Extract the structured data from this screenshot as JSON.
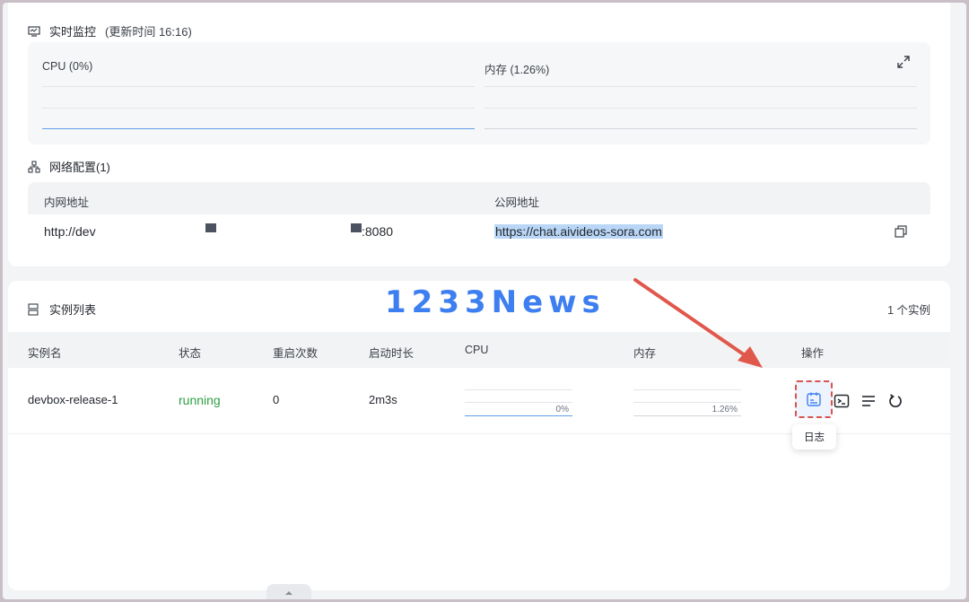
{
  "monitor": {
    "title": "实时监控",
    "updated": "(更新时间 16:16)",
    "cpu_label": "CPU (0%)",
    "mem_label": "内存 (1.26%)"
  },
  "network": {
    "title": "网络配置(1)",
    "col_internal": "内网地址",
    "col_public": "公网地址",
    "internal_prefix": "http://dev",
    "internal_suffix": ":8080",
    "public_url": "https://chat.aivideos-sora.com"
  },
  "instances": {
    "title": "实例列表",
    "count": "1 个实例",
    "columns": [
      "实例名",
      "状态",
      "重启次数",
      "启动时长",
      "CPU",
      "内存",
      "操作"
    ],
    "rows": [
      {
        "name": "devbox-release-1",
        "status": "running",
        "restarts": "0",
        "uptime": "2m3s",
        "cpu": "0%",
        "mem": "1.26%"
      }
    ],
    "tooltip": "日志"
  },
  "watermark": "1233News",
  "colors": {
    "accent": "#3d7ef0",
    "running": "#2f9e44",
    "arrow": "#e0584b"
  },
  "icons": {
    "monitor": "monitor-icon",
    "network": "network-icon",
    "list": "list-icon",
    "expand": "expand-icon",
    "copy": "copy-icon",
    "log": "log-icon",
    "terminal": "terminal-icon",
    "detail": "detail-icon",
    "restart": "restart-icon"
  }
}
